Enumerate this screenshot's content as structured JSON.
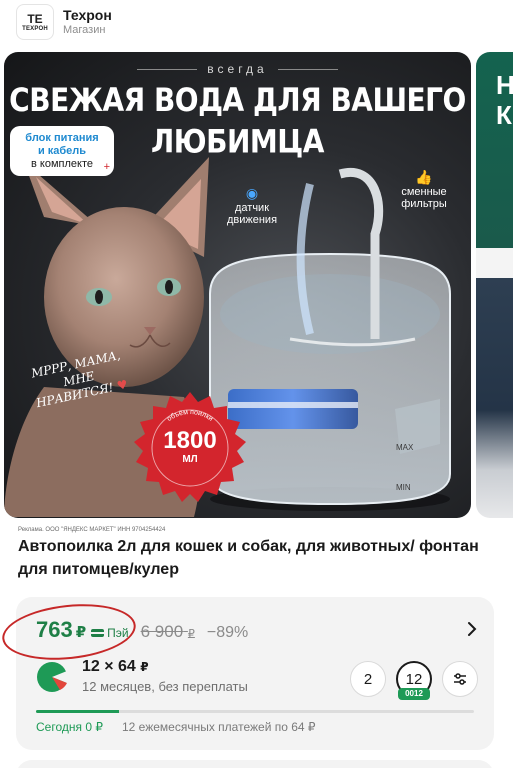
{
  "store": {
    "logo_mark": "ТЕ",
    "logo_text": "ТЕХРОН",
    "name": "Техрон",
    "subtitle": "Магазин"
  },
  "gallery": {
    "kicker": "всегда",
    "title_line1": "СВЕЖАЯ ВОДА ДЛЯ ВАШЕГО",
    "title_line2": "ЛЮБИМЦА",
    "badge_line1": "блок питания",
    "badge_line2": "и кабель",
    "badge_line3": "в комплекте",
    "badge_plus": "+",
    "feature1_line1": "датчик",
    "feature1_line2": "движения",
    "feature2_line1": "сменные",
    "feature2_line2": "фильтры",
    "speech_line1": "МРРР, МАМА, МНЕ",
    "speech_line2": "НРАВИТСЯ!",
    "speech_heart": "♥",
    "seal_value": "1800",
    "seal_unit": "МЛ",
    "seal_ring_text": "объём поилки",
    "fountain_max": "MAX",
    "fountain_min": "MIN",
    "next_card_text": "Н\nК"
  },
  "product": {
    "ad_note": "Реклама. ООО \"ЯНДЕКС МАРКЕТ\" ИНН 9704254424",
    "title": "Автопоилка 2л для кошек и собак, для животных/ фонтан для питомцев/кулер"
  },
  "price": {
    "current": "763",
    "currency": "₽",
    "pay_label": "Пэй",
    "old_value": "6 900",
    "old_currency": "₽",
    "discount": "−89%",
    "accent_color": "#1e7f46"
  },
  "split": {
    "amount": "12 × 64",
    "amount_currency": "₽",
    "description": "12 месяцев, без переплаты",
    "term_options": [
      "2",
      "12"
    ],
    "selected_term": "12",
    "term_badge": "0012",
    "progress_fraction": 0.19,
    "today": "Сегодня 0 ₽",
    "rest": "12 ежемесячных платежей по 64 ₽"
  }
}
